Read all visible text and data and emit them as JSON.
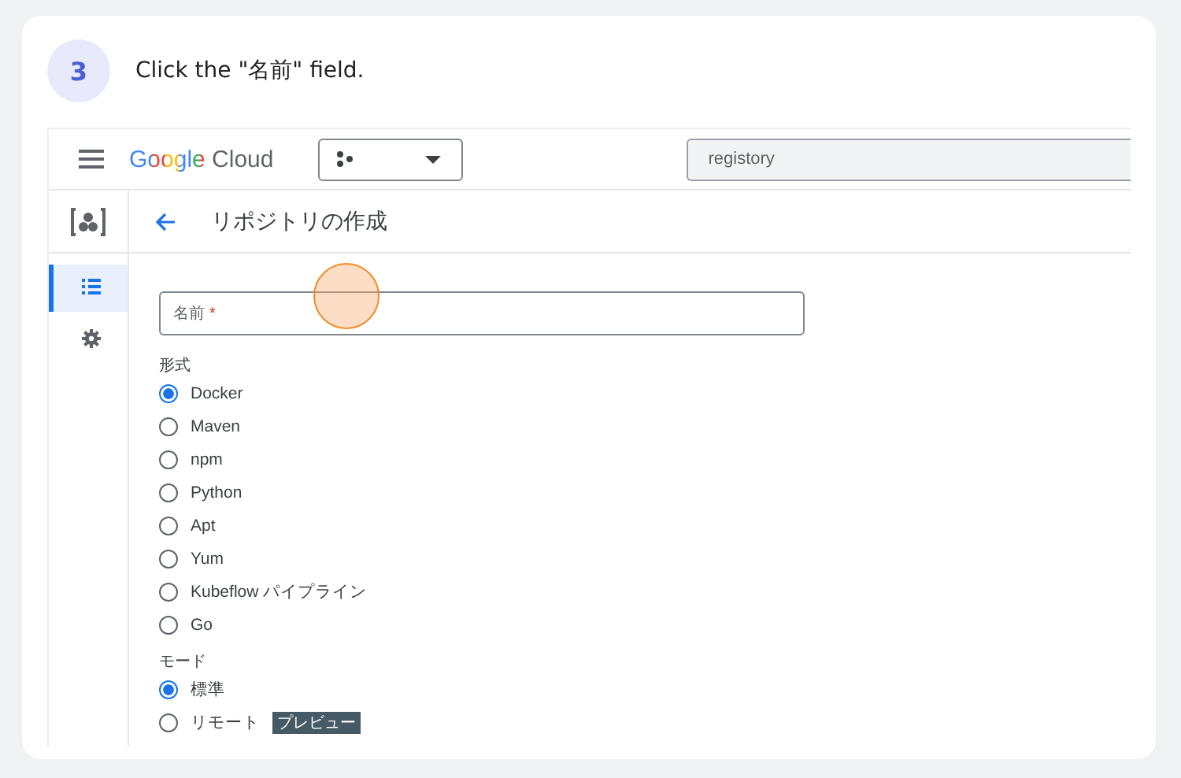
{
  "step": {
    "number": "3",
    "instruction": "Click the \"名前\" field."
  },
  "topbar": {
    "logo": "Google Cloud",
    "search": {
      "value": "registory"
    }
  },
  "page": {
    "title": "リポジトリの作成"
  },
  "rail": [
    {
      "kind": "list",
      "selected": true
    },
    {
      "kind": "gear",
      "selected": false
    }
  ],
  "form": {
    "name_field": {
      "label": "名前",
      "required_mark": "*"
    },
    "format": {
      "label": "形式",
      "options": [
        {
          "label": "Docker",
          "selected": true
        },
        {
          "label": "Maven",
          "selected": false
        },
        {
          "label": "npm",
          "selected": false
        },
        {
          "label": "Python",
          "selected": false
        },
        {
          "label": "Apt",
          "selected": false
        },
        {
          "label": "Yum",
          "selected": false
        },
        {
          "label": "Kubeflow パイプライン",
          "selected": false
        },
        {
          "label": "Go",
          "selected": false
        }
      ]
    },
    "mode": {
      "label": "モード",
      "options": [
        {
          "label": "標準",
          "selected": true
        },
        {
          "label": "リモート",
          "selected": false,
          "badge": "プレビュー"
        }
      ]
    }
  }
}
